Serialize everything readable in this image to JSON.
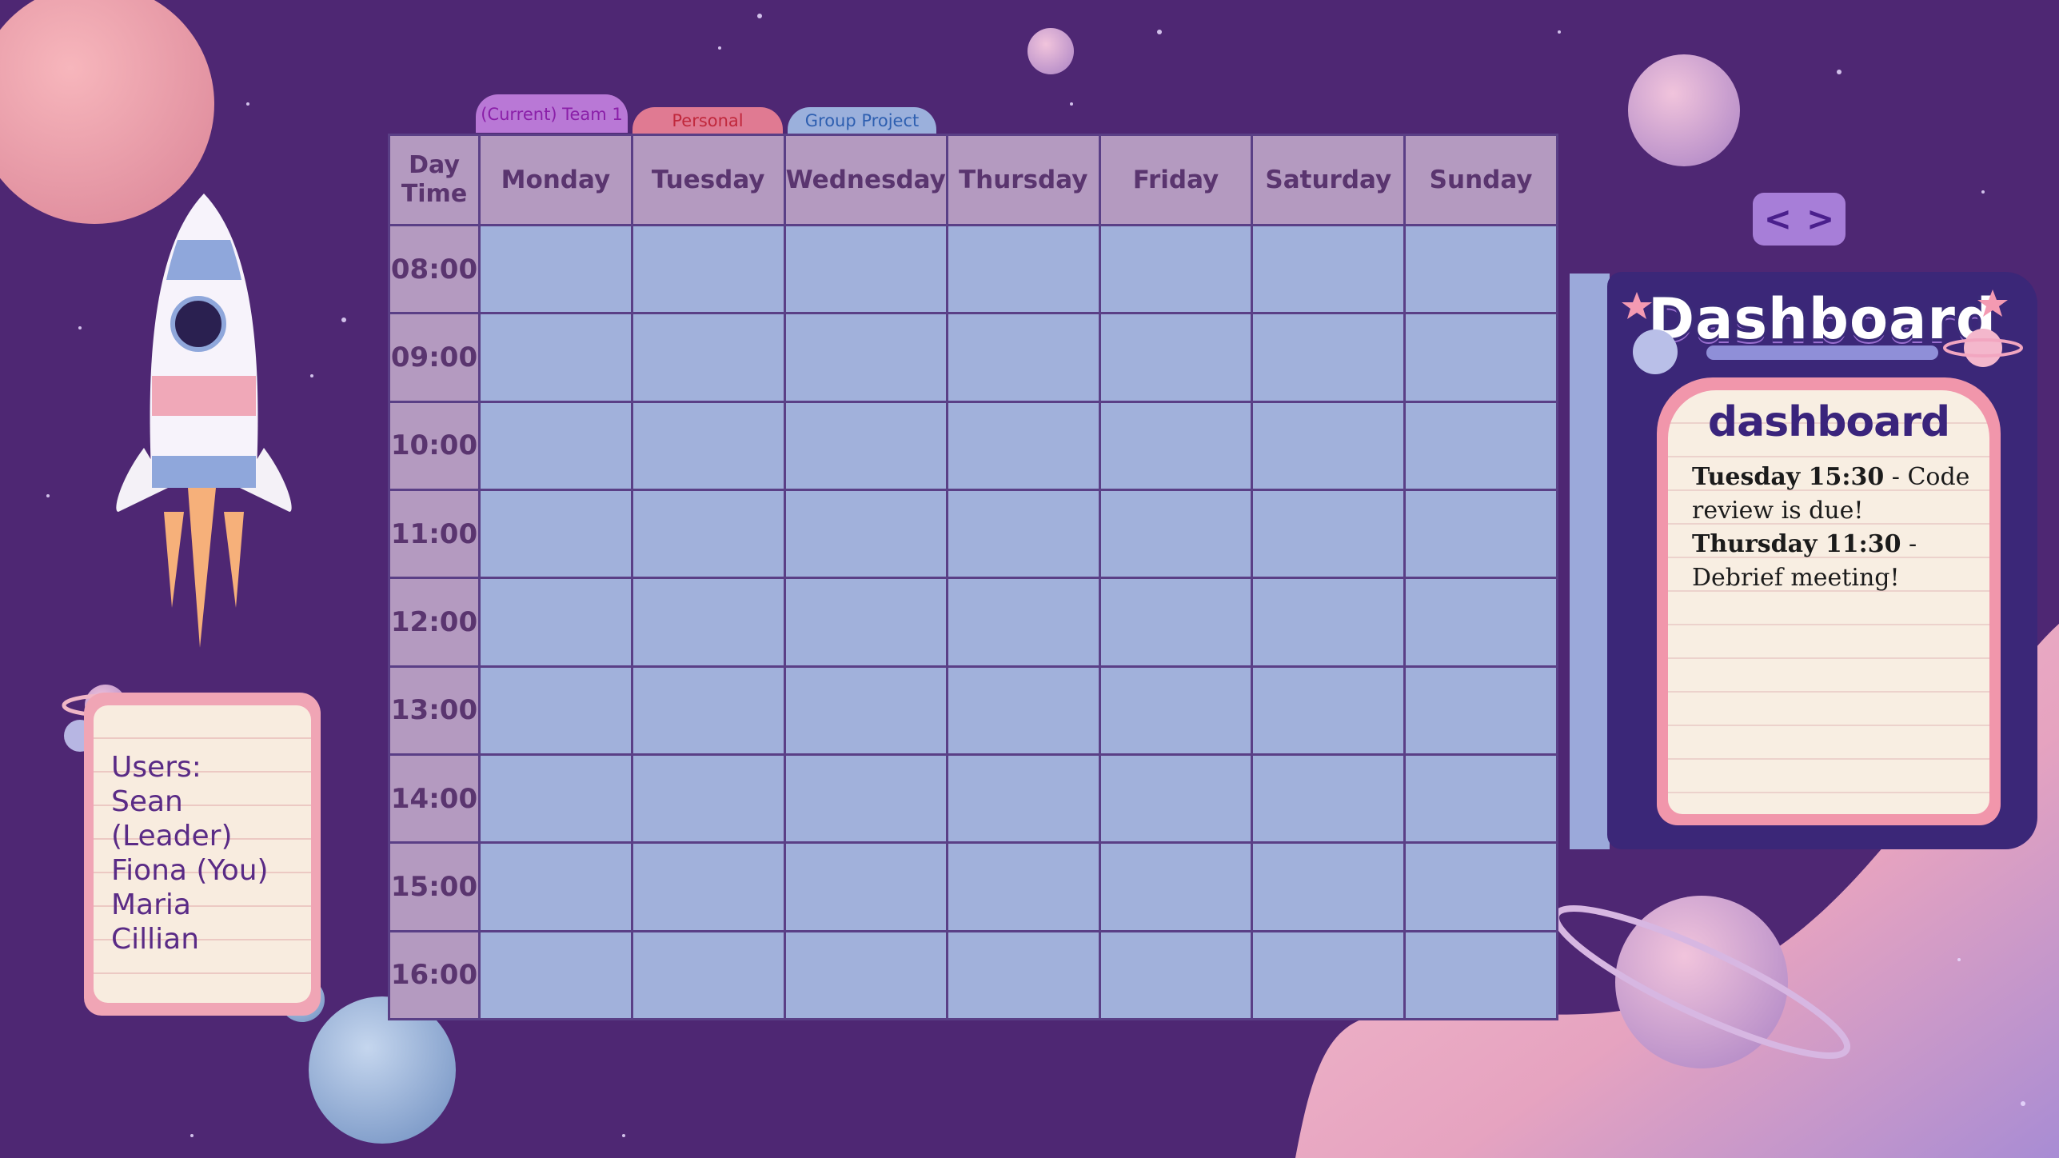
{
  "colors": {
    "background": "#4e2773",
    "header_cell": "#b49ac0",
    "slot_cell": "#a1b1db",
    "grid_line": "#5a3f86",
    "tab_team": "#b978d6",
    "tab_personal": "#e07a92",
    "tab_group": "#9bb0dc"
  },
  "tabs": [
    {
      "label": "(Current) Team 1",
      "color": "#8a1fa8"
    },
    {
      "label": "Personal",
      "color": "#c0283c"
    },
    {
      "label": "Group Project",
      "color": "#2e5fb0"
    }
  ],
  "timetable": {
    "corner": [
      "Day",
      "Time"
    ],
    "days": [
      "Monday",
      "Tuesday",
      "Wednesday",
      "Thursday",
      "Friday",
      "Saturday",
      "Sunday"
    ],
    "times": [
      "08:00",
      "09:00",
      "10:00",
      "11:00",
      "12:00",
      "13:00",
      "14:00",
      "15:00",
      "16:00"
    ]
  },
  "users": {
    "title": "Users:",
    "list": [
      "Sean (Leader)",
      "Fiona (You)",
      "Maria",
      "Cillian"
    ]
  },
  "dashboard": {
    "title": "Dashboard",
    "subtitle": "dashboard",
    "notes": [
      {
        "bold": "Tuesday 15:30",
        "rest": " - Code review is due!"
      },
      {
        "bold": "Thursday 11:30",
        "rest": " - Debrief meeting!"
      }
    ]
  },
  "nav": {
    "prev": "<",
    "next": ">"
  }
}
